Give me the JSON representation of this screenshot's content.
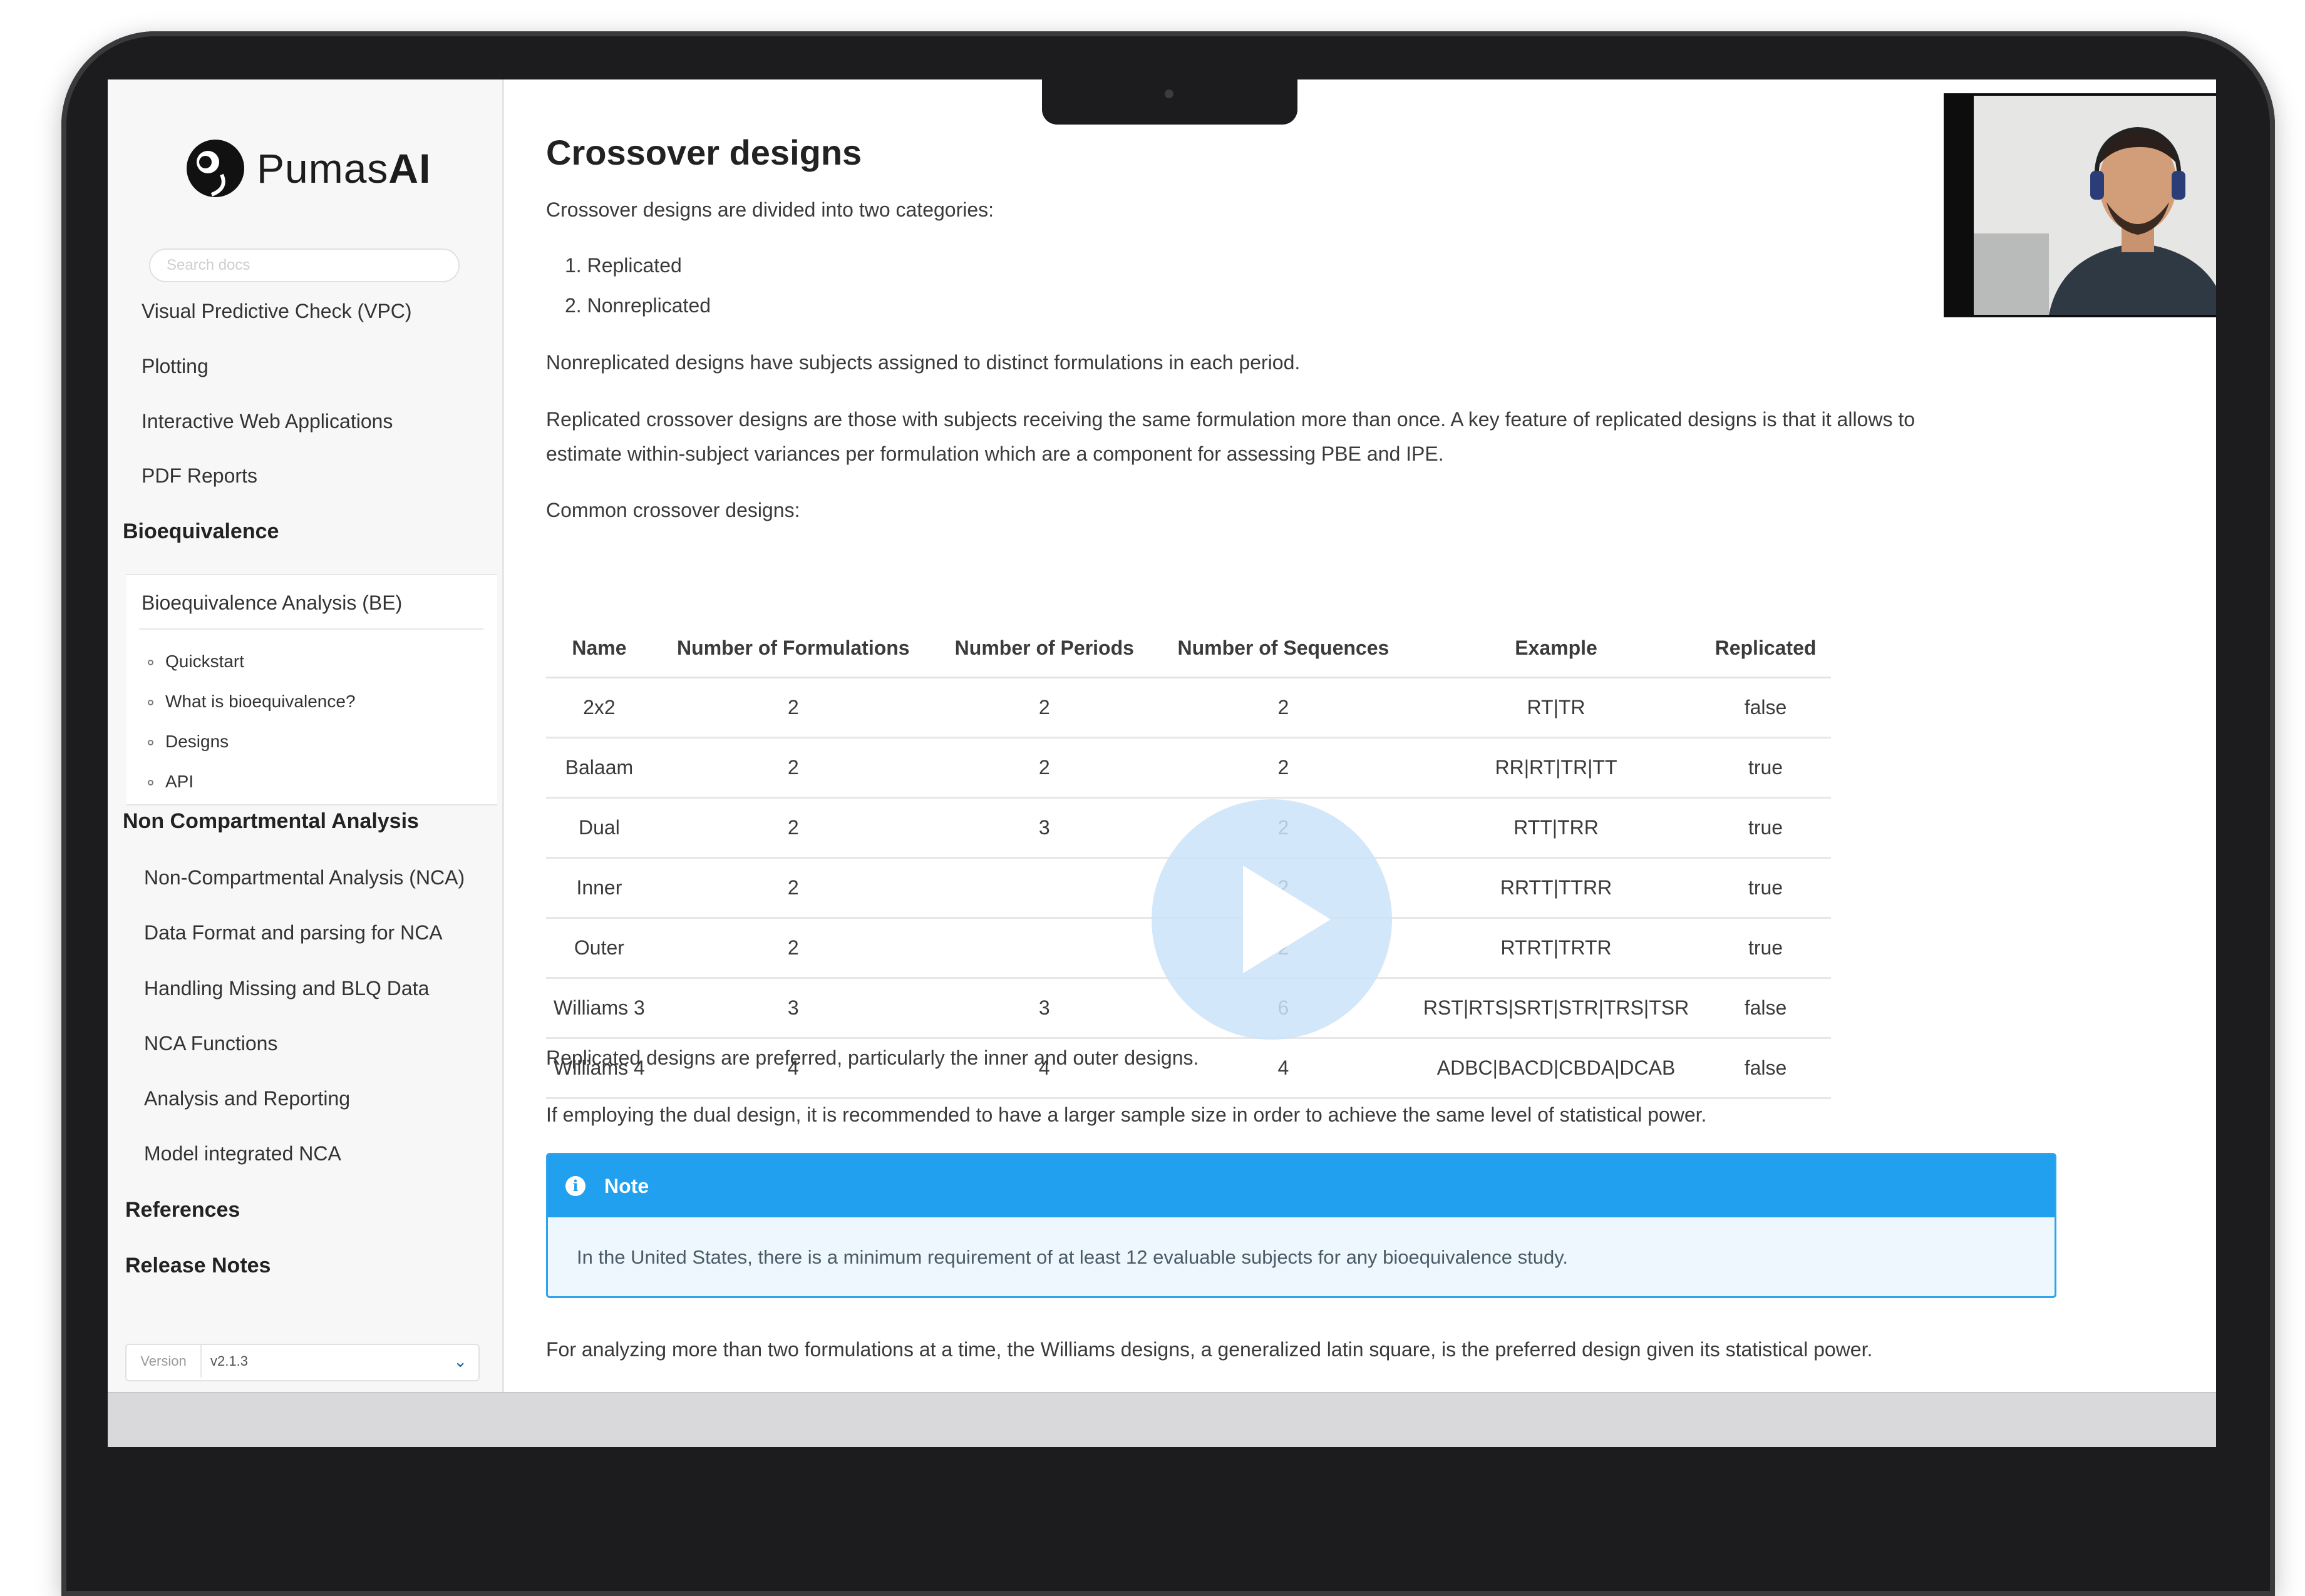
{
  "sidebar": {
    "logo": {
      "prefix": "Pumas",
      "suffix": "AI"
    },
    "search_placeholder": "Search docs",
    "top_items": [
      "Visual Predictive Check (VPC)",
      "Plotting",
      "Interactive Web Applications",
      "PDF Reports"
    ],
    "bioequivalence": {
      "heading": "Bioequivalence",
      "active_item": "Bioequivalence Analysis (BE)",
      "sub_items": [
        "Quickstart",
        "What is bioequivalence?",
        "Designs",
        "API"
      ]
    },
    "nca": {
      "heading": "Non Compartmental Analysis",
      "items": [
        "Non-Compartmental Analysis (NCA)",
        "Data Format and parsing for NCA",
        "Handling Missing and BLQ Data",
        "NCA Functions",
        "Analysis and Reporting",
        "Model integrated NCA"
      ]
    },
    "references": "References",
    "release_notes": "Release Notes",
    "version": {
      "label": "Version",
      "value": "v2.1.3"
    }
  },
  "main": {
    "title": "Crossover designs",
    "intro": "Crossover designs are divided into two categories:",
    "categories": [
      "1. Replicated",
      "2. Nonreplicated"
    ],
    "nonreplicated_text": "Nonreplicated designs have subjects assigned to distinct formulations in each period.",
    "replicated_text_1": "Replicated crossover designs are those with subjects receiving the same formulation more than once. A key feature of replicated designs is that it allows to",
    "replicated_text_2": "estimate within-subject variances per formulation which are a component for assessing PBE and IPE.",
    "common_text": "Common crossover designs:",
    "table": {
      "headers": [
        "Name",
        "Number of Formulations",
        "Number of Periods",
        "Number of Sequences",
        "Example",
        "Replicated"
      ],
      "rows": [
        [
          "2x2",
          "2",
          "2",
          "2",
          "RT|TR",
          "false"
        ],
        [
          "Balaam",
          "2",
          "2",
          "2",
          "RR|RT|TR|TT",
          "true"
        ],
        [
          "Dual",
          "2",
          "3",
          "2",
          "RTT|TRR",
          "true"
        ],
        [
          "Inner",
          "2",
          "",
          "2",
          "RRTT|TTRR",
          "true"
        ],
        [
          "Outer",
          "2",
          "",
          "2",
          "RTRT|TRTR",
          "true"
        ],
        [
          "Williams 3",
          "3",
          "3",
          "6",
          "RST|RTS|SRT|STR|TRS|TSR",
          "false"
        ],
        [
          "Williams 4",
          "4",
          "4",
          "4",
          "ADBC|BACD|CBDA|DCAB",
          "false"
        ]
      ]
    },
    "preferred_text": "Replicated designs are preferred, particularly the inner and outer designs.",
    "dual_text": "If employing the dual design, it is recommended to have a larger sample size in order to achieve the same level of statistical power.",
    "note": {
      "title": "Note",
      "body": "In the United States, there is a minimum requirement of at least 12 evaluable subjects for any bioequivalence study."
    },
    "williams_text": "For analyzing more than two formulations at a time, the Williams designs, a generalized latin square, is the preferred design given its statistical power."
  },
  "colors": {
    "note_header": "#20a0ee",
    "note_body_bg": "#eef7fd",
    "play_button": "#cbe3fa",
    "laptop_frame": "#1c1c1e"
  },
  "icons": {
    "note": "info-circle-icon",
    "play": "play-icon",
    "version_dropdown": "chevron-down-icon"
  }
}
